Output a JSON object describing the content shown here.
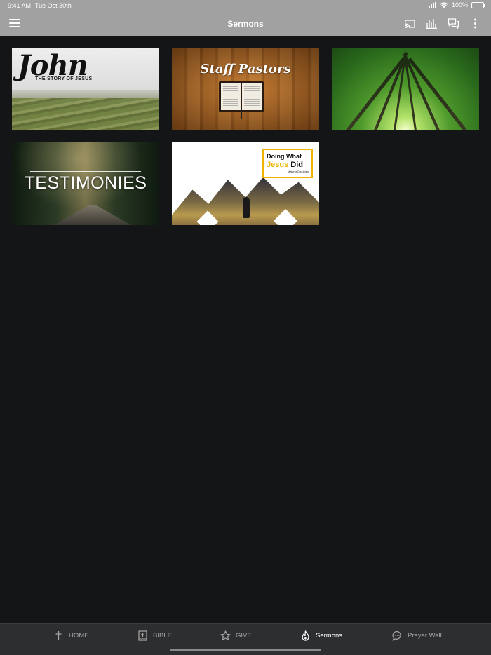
{
  "status_bar": {
    "time": "9:41 AM",
    "date": "Tue Oct 30th",
    "battery": "100%"
  },
  "header": {
    "title": "Sermons",
    "icons": [
      "menu-icon",
      "cast-icon",
      "audio-bars-icon",
      "chat-icon",
      "more-vertical-icon"
    ]
  },
  "sermons": [
    {
      "title": "John",
      "subtitle": "THE STORY OF JESUS"
    },
    {
      "title": "Staff Pastors"
    },
    {
      "title": ""
    },
    {
      "title": "TESTIMONIES"
    },
    {
      "title_line1": "Doing What",
      "title_line2a": "Jesus",
      "title_line2b": "Did",
      "subtitle": "Making Disciples"
    }
  ],
  "tabs": [
    {
      "label": "HOME",
      "icon": "cross-icon",
      "active": false
    },
    {
      "label": "BIBLE",
      "icon": "bible-icon",
      "active": false
    },
    {
      "label": "GIVE",
      "icon": "star-icon",
      "active": false
    },
    {
      "label": "Sermons",
      "icon": "flame-icon",
      "active": true
    },
    {
      "label": "Prayer Wall",
      "icon": "speech-bubble-icon",
      "active": false
    }
  ],
  "colors": {
    "header_bg": "#a1a1a1",
    "page_bg": "#141517",
    "tabbar_bg": "#2d2e30",
    "accent_yellow": "#f0b400"
  }
}
